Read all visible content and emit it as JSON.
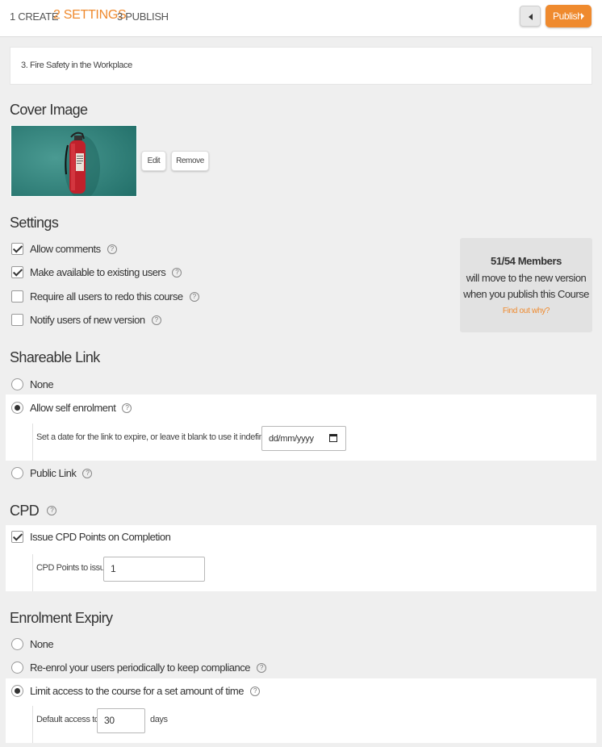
{
  "header": {
    "steps": [
      {
        "label": "1 CREATE"
      },
      {
        "label": "2 SETTINGS"
      },
      {
        "label": "3 PUBLISH"
      }
    ],
    "publish_label": "Publish"
  },
  "course_title": "3. Fire Safety in the Workplace",
  "cover": {
    "heading": "Cover Image",
    "edit_label": "Edit",
    "remove_label": "Remove"
  },
  "settings": {
    "heading": "Settings",
    "options": [
      {
        "label": "Allow comments",
        "checked": true
      },
      {
        "label": "Make available to existing users",
        "checked": true
      },
      {
        "label": "Require all users to redo this course",
        "checked": false
      },
      {
        "label": "Notify users of new version",
        "checked": false
      }
    ],
    "info": {
      "members": "51/54 Members",
      "line1": "will move to the new version",
      "line2": "when you publish this Course",
      "link": "Find out why?"
    }
  },
  "shareable": {
    "heading": "Shareable Link",
    "none_label": "None",
    "self_label": "Allow self enrolment",
    "expire_text": "Set a date for the link to expire, or leave it blank to use it indefinitely",
    "date_placeholder": "dd/mm/yyyy",
    "public_label": "Public Link",
    "selected": "self"
  },
  "cpd": {
    "heading": "CPD",
    "issue_label": "Issue CPD Points on Completion",
    "issue_checked": true,
    "points_label": "CPD Points to issue",
    "points_value": "1"
  },
  "expiry": {
    "heading": "Enrolment Expiry",
    "none_label": "None",
    "reenrol_label": "Re-enrol your users periodically to keep compliance",
    "limit_label": "Limit access to the course for a set amount of time",
    "default_label": "Default access to",
    "default_value": "30",
    "days_label": "days",
    "selected": "limit"
  },
  "colors": {
    "accent": "#ef8a2e",
    "background": "#efefef"
  },
  "icons": {
    "help": "question-circle-icon",
    "back": "caret-left-icon",
    "forward": "caret-right-icon",
    "calendar": "calendar-icon"
  }
}
